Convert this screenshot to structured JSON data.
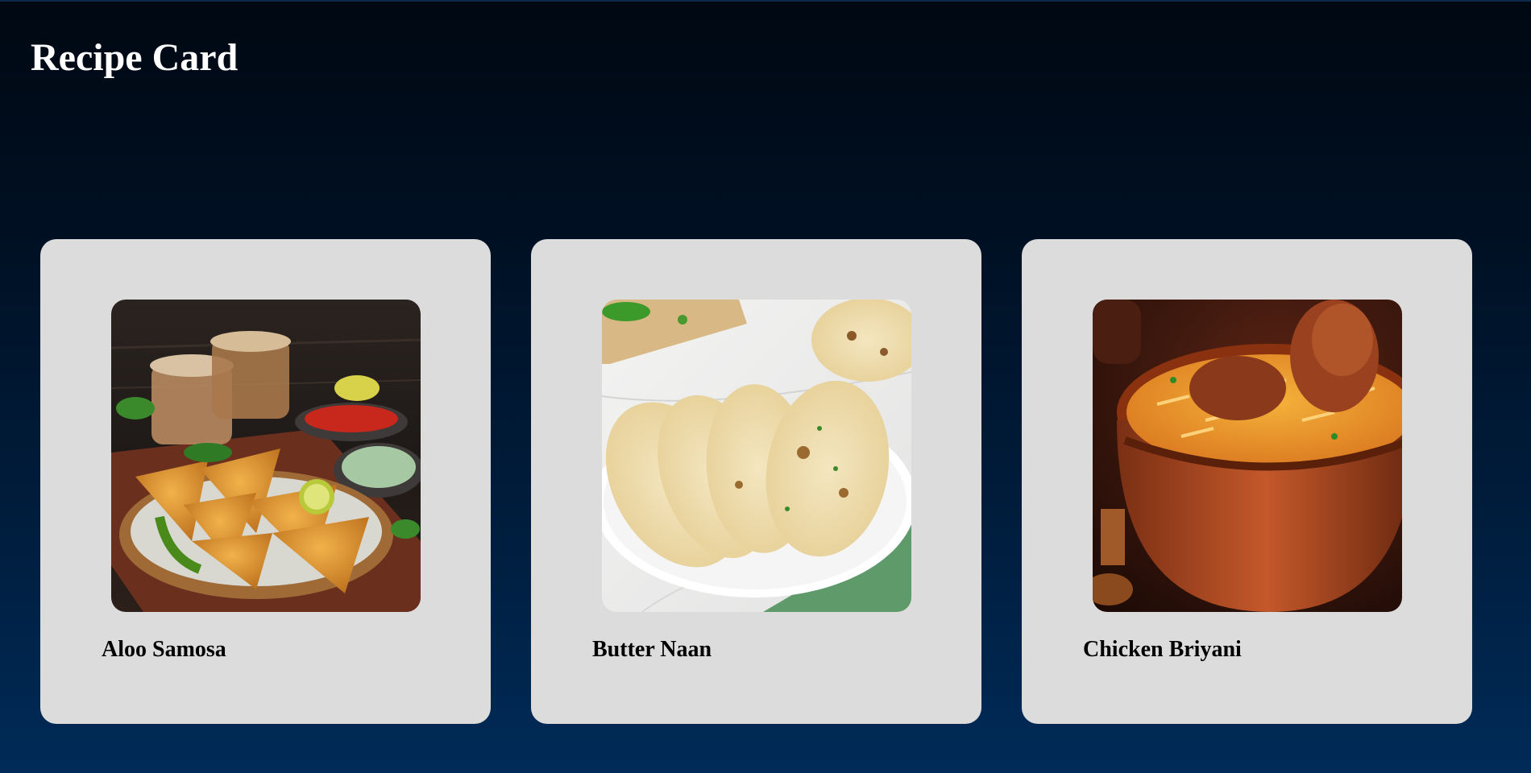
{
  "page": {
    "title": "Recipe Card"
  },
  "cards": [
    {
      "name": "Aloo Samosa",
      "image_icon": "samosa-photo"
    },
    {
      "name": "Butter Naan",
      "image_icon": "naan-photo"
    },
    {
      "name": "Chicken Briyani",
      "image_icon": "biryani-photo"
    }
  ],
  "colors": {
    "background_top": "#000812",
    "background_bottom": "#002b58",
    "card": "#dcdcdc",
    "title_text": "#ffffff",
    "card_text": "#000000"
  }
}
